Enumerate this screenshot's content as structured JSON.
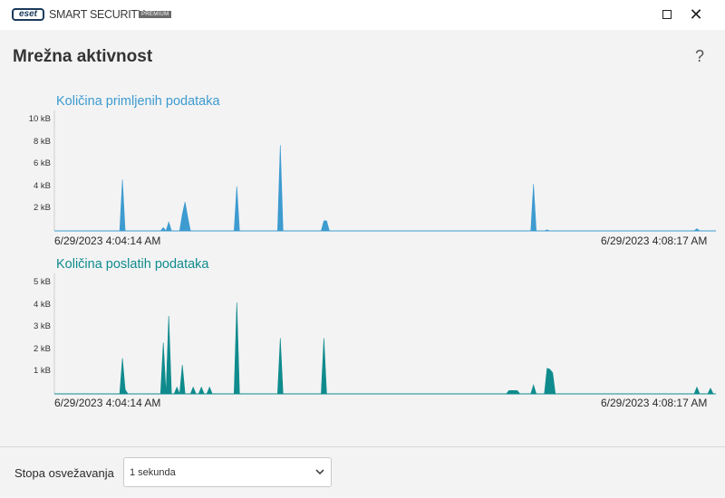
{
  "window": {
    "logo": "eset",
    "product": "SMART SECURITY",
    "edition": "PREMIUM",
    "controls": [
      "minimize-icon",
      "maximize-icon",
      "close-icon"
    ],
    "close_symbol": "✕"
  },
  "page": {
    "title": "Mrežna aktivnost",
    "help": "?"
  },
  "colors": {
    "received": "#3d9bd0",
    "sent": "#0f8b8d"
  },
  "chart_data": [
    {
      "type": "area",
      "title": "Količina primljenih podataka",
      "unit": "kB",
      "ylim": [
        0,
        10
      ],
      "yticks": [
        "10 kB",
        "8 kB",
        "6 kB",
        "4 kB",
        "2 kB"
      ],
      "ytick_values": [
        10,
        8,
        6,
        4,
        2
      ],
      "x_start_label": "6/29/2023 4:04:14 AM",
      "x_end_label": "6/29/2023 4:08:17 AM",
      "duration_s": 243,
      "color": "#3d9bd0",
      "points": [
        [
          0,
          0
        ],
        [
          24,
          0
        ],
        [
          25,
          4.6
        ],
        [
          26,
          0
        ],
        [
          39,
          0
        ],
        [
          40,
          0.3
        ],
        [
          41,
          0
        ],
        [
          42,
          0.8
        ],
        [
          43,
          0
        ],
        [
          46,
          0
        ],
        [
          47,
          1.5
        ],
        [
          48,
          2.6
        ],
        [
          49,
          1.2
        ],
        [
          50,
          0
        ],
        [
          66,
          0
        ],
        [
          67,
          4.0
        ],
        [
          68,
          0
        ],
        [
          82,
          0
        ],
        [
          83,
          7.7
        ],
        [
          84,
          0
        ],
        [
          98,
          0
        ],
        [
          99,
          0.9
        ],
        [
          100,
          0.9
        ],
        [
          101,
          0
        ],
        [
          175,
          0
        ],
        [
          176,
          4.2
        ],
        [
          177,
          0
        ],
        [
          180,
          0
        ],
        [
          181,
          0.1
        ],
        [
          182,
          0
        ],
        [
          235,
          0
        ],
        [
          236,
          0.2
        ],
        [
          237,
          0
        ],
        [
          243,
          0
        ]
      ]
    },
    {
      "type": "area",
      "title": "Količina poslatih podataka",
      "unit": "kB",
      "ylim": [
        0,
        5
      ],
      "yticks": [
        "5 kB",
        "4 kB",
        "3 kB",
        "2 kB",
        "1 kB"
      ],
      "ytick_values": [
        5,
        4,
        3,
        2,
        1
      ],
      "x_start_label": "6/29/2023 4:04:14 AM",
      "x_end_label": "6/29/2023 4:08:17 AM",
      "duration_s": 243,
      "color": "#0f8b8d",
      "points": [
        [
          0,
          0
        ],
        [
          24,
          0
        ],
        [
          25,
          1.6
        ],
        [
          26,
          0.2
        ],
        [
          27,
          0
        ],
        [
          39,
          0
        ],
        [
          40,
          2.3
        ],
        [
          41,
          0
        ],
        [
          42,
          3.5
        ],
        [
          43,
          0
        ],
        [
          44,
          0
        ],
        [
          45,
          0.3
        ],
        [
          46,
          0
        ],
        [
          47,
          1.3
        ],
        [
          48,
          0
        ],
        [
          50,
          0
        ],
        [
          51,
          0.3
        ],
        [
          52,
          0
        ],
        [
          53,
          0
        ],
        [
          54,
          0.3
        ],
        [
          55,
          0
        ],
        [
          56,
          0
        ],
        [
          57,
          0.3
        ],
        [
          58,
          0
        ],
        [
          66,
          0
        ],
        [
          67,
          4.1
        ],
        [
          68,
          0
        ],
        [
          82,
          0
        ],
        [
          83,
          2.5
        ],
        [
          84,
          0
        ],
        [
          98,
          0
        ],
        [
          99,
          2.5
        ],
        [
          100,
          0
        ],
        [
          166,
          0
        ],
        [
          167,
          0.15
        ],
        [
          170,
          0.15
        ],
        [
          171,
          0
        ],
        [
          175,
          0
        ],
        [
          176,
          0.4
        ],
        [
          177,
          0
        ],
        [
          180,
          0
        ],
        [
          181,
          1.15
        ],
        [
          182,
          1.1
        ],
        [
          183,
          0.95
        ],
        [
          184,
          0
        ],
        [
          235,
          0
        ],
        [
          236,
          0.3
        ],
        [
          237,
          0
        ],
        [
          240,
          0
        ],
        [
          241,
          0.25
        ],
        [
          242,
          0
        ],
        [
          243,
          0
        ]
      ]
    }
  ],
  "footer": {
    "refresh_label": "Stopa osvežavanja",
    "refresh_value": "1 sekunda"
  }
}
